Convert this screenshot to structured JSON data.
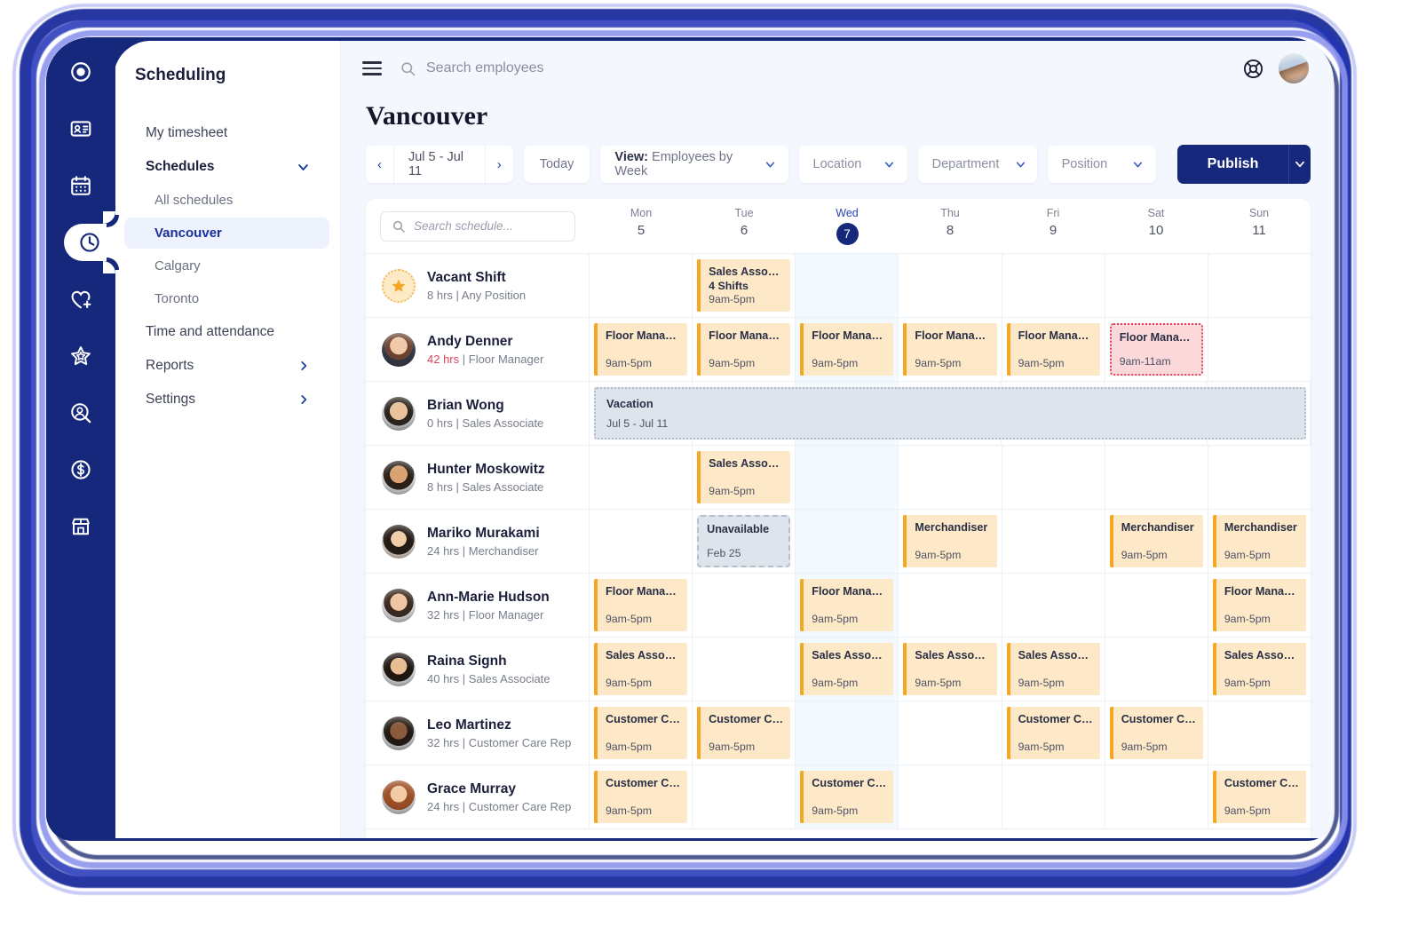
{
  "colors": {
    "navy": "#16287c",
    "accent_blue": "#2a46b5",
    "shift_bg": "#fde9c8",
    "shift_bar": "#f5a623",
    "alert_bg": "#fbd9db",
    "alert_border": "#e2445c",
    "timeoff_bg": "#dde4ec",
    "today_col": "#f3fafd"
  },
  "rail": {
    "items": [
      {
        "icon": "logo-icon",
        "active": false
      },
      {
        "icon": "id-card-icon",
        "active": false
      },
      {
        "icon": "calendar-icon",
        "active": false
      },
      {
        "icon": "clock-icon",
        "active": true
      },
      {
        "icon": "heart-plus-icon",
        "active": false
      },
      {
        "icon": "star-badge-icon",
        "active": false
      },
      {
        "icon": "person-search-icon",
        "active": false
      },
      {
        "icon": "dollar-circle-icon",
        "active": false
      },
      {
        "icon": "storefront-icon",
        "active": false
      }
    ]
  },
  "sidebar": {
    "title": "Scheduling",
    "items": [
      {
        "label": "My timesheet",
        "type": "link"
      },
      {
        "label": "Schedules",
        "type": "group",
        "expanded": true
      },
      {
        "label": "All schedules",
        "type": "sub"
      },
      {
        "label": "Vancouver",
        "type": "sub",
        "active": true
      },
      {
        "label": "Calgary",
        "type": "sub"
      },
      {
        "label": "Toronto",
        "type": "sub"
      },
      {
        "label": "Time and attendance",
        "type": "link"
      },
      {
        "label": "Reports",
        "type": "link",
        "chevron": "right"
      },
      {
        "label": "Settings",
        "type": "link",
        "chevron": "right"
      }
    ]
  },
  "topbar": {
    "search_placeholder": "Search employees",
    "help_icon": "lifebuoy-icon",
    "avatar": "user-avatar"
  },
  "header": {
    "page_title": "Vancouver"
  },
  "toolbar": {
    "prev": "‹",
    "next": "›",
    "date_range": "Jul 5 - Jul 11",
    "today_label": "Today",
    "view_prefix": "View:",
    "view_value": "Employees by Week",
    "location_placeholder": "Location",
    "department_placeholder": "Department",
    "position_placeholder": "Position",
    "publish_label": "Publish"
  },
  "schedule": {
    "search_placeholder": "Search schedule...",
    "days": [
      {
        "name": "Mon",
        "num": "5",
        "today": false
      },
      {
        "name": "Tue",
        "num": "6",
        "today": false
      },
      {
        "name": "Wed",
        "num": "7",
        "today": true
      },
      {
        "name": "Thu",
        "num": "8",
        "today": false
      },
      {
        "name": "Fri",
        "num": "9",
        "today": false
      },
      {
        "name": "Sat",
        "num": "10",
        "today": false
      },
      {
        "name": "Sun",
        "num": "11",
        "today": false
      }
    ],
    "rows": [
      {
        "name": "Vacant Shift",
        "hours": "8 hrs",
        "position": "Any Position",
        "hours_alert": false,
        "avatar": "vacant-star-icon",
        "cells": [
          null,
          {
            "kind": "shift",
            "title": "Sales Associate",
            "sub": "4 Shifts",
            "time": "9am-5pm"
          },
          null,
          null,
          null,
          null,
          null
        ]
      },
      {
        "name": "Andy Denner",
        "hours": "42 hrs",
        "position": "Floor Manager",
        "hours_alert": true,
        "avatar": "av1",
        "cells": [
          {
            "kind": "shift",
            "title": "Floor Manager",
            "time": "9am-5pm"
          },
          {
            "kind": "shift",
            "title": "Floor Manager",
            "time": "9am-5pm"
          },
          {
            "kind": "shift",
            "title": "Floor Manager",
            "time": "9am-5pm"
          },
          {
            "kind": "shift",
            "title": "Floor Manager",
            "time": "9am-5pm"
          },
          {
            "kind": "shift",
            "title": "Floor Manager",
            "time": "9am-5pm"
          },
          {
            "kind": "alert",
            "title": "Floor Manager",
            "time": "9am-11am"
          },
          null
        ]
      },
      {
        "name": "Brian Wong",
        "hours": "0 hrs",
        "position": "Sales Associate",
        "hours_alert": false,
        "avatar": "av2",
        "fullspan": {
          "kind": "timeoff",
          "title": "Vacation",
          "time": "Jul 5 - Jul 11"
        },
        "cells": [
          null,
          null,
          null,
          null,
          null,
          null,
          null
        ]
      },
      {
        "name": "Hunter Moskowitz",
        "hours": "8 hrs",
        "position": "Sales Associate",
        "hours_alert": false,
        "avatar": "av3",
        "cells": [
          null,
          {
            "kind": "shift",
            "title": "Sales Associate",
            "time": "9am-5pm"
          },
          null,
          null,
          null,
          null,
          null
        ]
      },
      {
        "name": "Mariko Murakami",
        "hours": "24 hrs",
        "position": "Merchandiser",
        "hours_alert": false,
        "avatar": "av4",
        "cells": [
          null,
          {
            "kind": "unavailable",
            "title": "Unavailable",
            "time": "Feb 25"
          },
          null,
          {
            "kind": "shift",
            "title": "Merchandiser",
            "time": "9am-5pm"
          },
          null,
          {
            "kind": "shift",
            "title": "Merchandiser",
            "time": "9am-5pm"
          },
          {
            "kind": "shift",
            "title": "Merchandiser",
            "time": "9am-5pm"
          }
        ]
      },
      {
        "name": "Ann-Marie Hudson",
        "hours": "32 hrs",
        "position": "Floor Manager",
        "hours_alert": false,
        "avatar": "av5",
        "cells": [
          {
            "kind": "shift",
            "title": "Floor Manager",
            "time": "9am-5pm"
          },
          null,
          {
            "kind": "shift",
            "title": "Floor Manager",
            "time": "9am-5pm"
          },
          null,
          null,
          null,
          {
            "kind": "shift",
            "title": "Floor Manager",
            "time": "9am-5pm"
          }
        ]
      },
      {
        "name": "Raina Signh",
        "hours": "40 hrs",
        "position": "Sales Associate",
        "hours_alert": false,
        "avatar": "av6",
        "cells": [
          {
            "kind": "shift",
            "title": "Sales Associate",
            "time": "9am-5pm"
          },
          null,
          {
            "kind": "shift",
            "title": "Sales Associate",
            "time": "9am-5pm"
          },
          {
            "kind": "shift",
            "title": "Sales Associate",
            "time": "9am-5pm"
          },
          {
            "kind": "shift",
            "title": "Sales Associate",
            "time": "9am-5pm"
          },
          null,
          {
            "kind": "shift",
            "title": "Sales Associate",
            "time": "9am-5pm"
          }
        ]
      },
      {
        "name": "Leo Martinez",
        "hours": "32 hrs",
        "position": "Customer Care Rep",
        "hours_alert": false,
        "avatar": "av7",
        "cells": [
          {
            "kind": "shift",
            "title": "Customer Care...",
            "time": "9am-5pm"
          },
          {
            "kind": "shift",
            "title": "Customer Care...",
            "time": "9am-5pm"
          },
          null,
          null,
          {
            "kind": "shift",
            "title": "Customer Care...",
            "time": "9am-5pm"
          },
          {
            "kind": "shift",
            "title": "Customer Care...",
            "time": "9am-5pm"
          },
          null
        ]
      },
      {
        "name": "Grace Murray",
        "hours": "24 hrs",
        "position": "Customer Care Rep",
        "hours_alert": false,
        "avatar": "av8",
        "cells": [
          {
            "kind": "shift",
            "title": "Customer Care...",
            "time": "9am-5pm"
          },
          null,
          {
            "kind": "shift",
            "title": "Customer Care...",
            "time": "9am-5pm"
          },
          null,
          null,
          null,
          {
            "kind": "shift",
            "title": "Customer Care...",
            "time": "9am-5pm"
          }
        ]
      }
    ]
  }
}
